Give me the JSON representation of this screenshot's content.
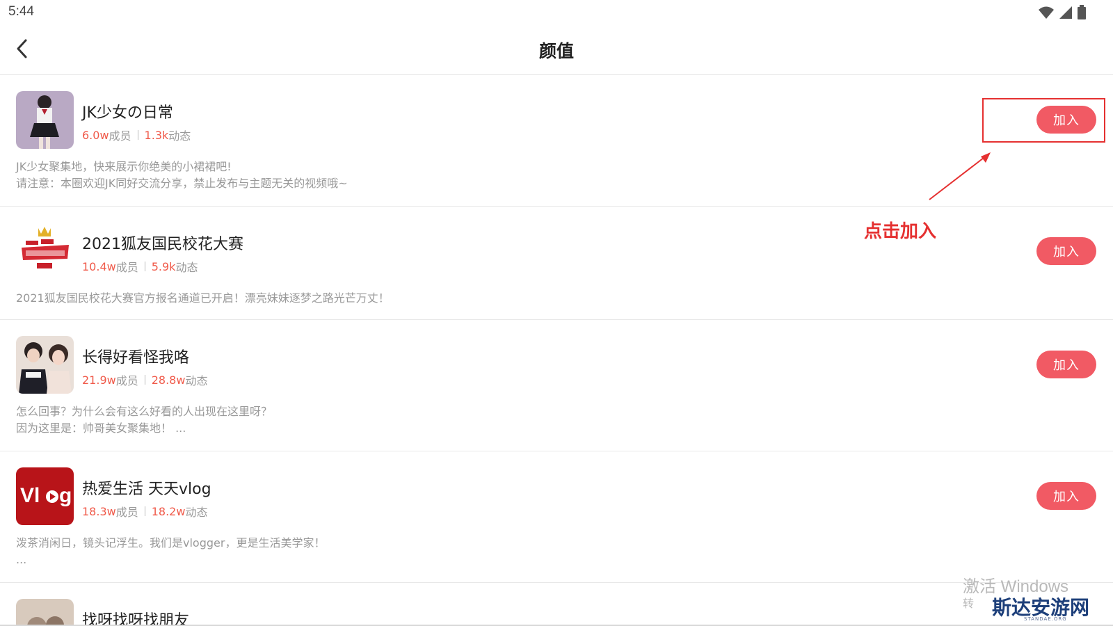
{
  "status_bar": {
    "time": "5:44",
    "icons": [
      "wifi-icon",
      "signal-icon",
      "battery-icon"
    ]
  },
  "top_bar": {
    "title": "颜值",
    "back_icon": "chevron-left-icon"
  },
  "groups": [
    {
      "name": "JK少女の日常",
      "members": "6.0w",
      "members_suffix": "成员",
      "posts": "1.3k",
      "posts_suffix": "动态",
      "desc_line1": "JK少女聚集地，快来展示你绝美的小裙裙吧!",
      "desc_line2": "请注意：本圈欢迎JK同好交流分享，禁止发布与主题无关的视频哦~",
      "join_label": "加入"
    },
    {
      "name": "2021狐友国民校花大赛",
      "members": "10.4w",
      "members_suffix": "成员",
      "posts": "5.9k",
      "posts_suffix": "动态",
      "desc_line1": "2021狐友国民校花大赛官方报名通道已开启！漂亮妹妹逐梦之路光芒万丈！",
      "desc_line2": "",
      "join_label": "加入"
    },
    {
      "name": "长得好看怪我咯",
      "members": "21.9w",
      "members_suffix": "成员",
      "posts": "28.8w",
      "posts_suffix": "动态",
      "desc_line1": "怎么回事？为什么会有这么好看的人出现在这里呀？",
      "desc_line2": "因为这里是：帅哥美女聚集地！ ...",
      "join_label": "加入"
    },
    {
      "name": "热爱生活 天天vlog",
      "members": "18.3w",
      "members_suffix": "成员",
      "posts": "18.2w",
      "posts_suffix": "动态",
      "desc_line1": "泼茶消闲日，镜头记浮生。我们是vlogger，更是生活美学家！",
      "desc_line2": "...",
      "join_label": "加入"
    },
    {
      "name": "找呀找呀找朋友"
    }
  ],
  "annotation": {
    "text": "点击加入",
    "color": "#e53030"
  },
  "watermark": {
    "windows": "激活 Windows",
    "windows_sub": "转",
    "site": "斯达安游网",
    "site_sub": "STANDAE.ORG"
  },
  "colors": {
    "accent": "#f15a64",
    "stat": "#f05a4a"
  }
}
